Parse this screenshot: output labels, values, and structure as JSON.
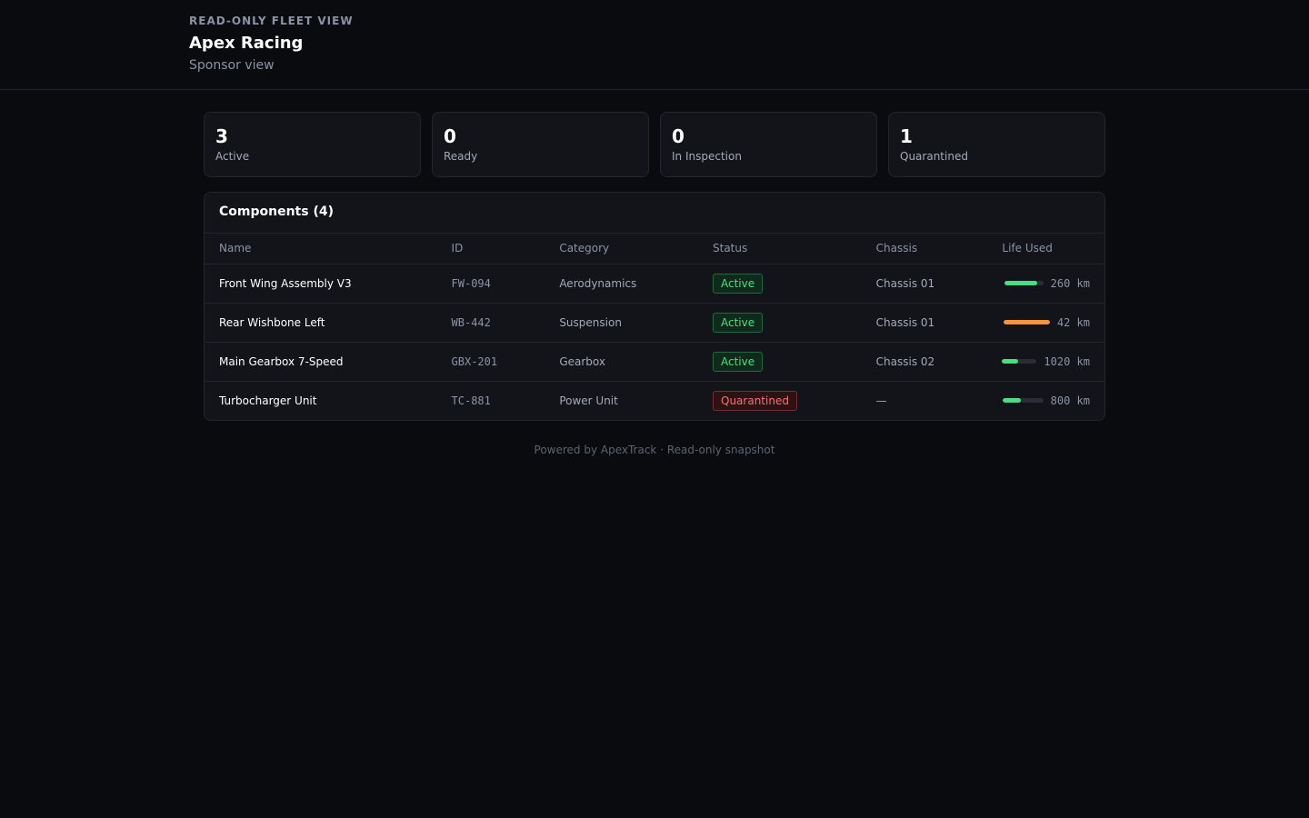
{
  "header": {
    "eyebrow": "READ-ONLY FLEET VIEW",
    "team": "Apex Racing",
    "subtitle": "Sponsor view"
  },
  "stats": [
    {
      "value": "3",
      "label": "Active"
    },
    {
      "value": "0",
      "label": "Ready"
    },
    {
      "value": "0",
      "label": "In Inspection"
    },
    {
      "value": "1",
      "label": "Quarantined"
    }
  ],
  "components": {
    "title": "Components (4)",
    "columns": [
      "Name",
      "ID",
      "Category",
      "Status",
      "Chassis",
      "Life Used"
    ],
    "rows": [
      {
        "name": "Front Wing Assembly V3",
        "id": "FW-094",
        "category": "Aerodynamics",
        "status": "Active",
        "status_kind": "active",
        "chassis": "Chassis 01",
        "life_text": "260 km",
        "life_fraction": 0.85,
        "life_color": "#4ade80"
      },
      {
        "name": "Rear Wishbone Left",
        "id": "WB-442",
        "category": "Suspension",
        "status": "Active",
        "status_kind": "active",
        "chassis": "Chassis 01",
        "life_text": "42 km",
        "life_fraction": 1.0,
        "life_color": "#fb923c"
      },
      {
        "name": "Main Gearbox 7-Speed",
        "id": "GBX-201",
        "category": "Gearbox",
        "status": "Active",
        "status_kind": "active",
        "chassis": "Chassis 02",
        "life_text": "1020 km",
        "life_fraction": 0.45,
        "life_color": "#4ade80"
      },
      {
        "name": "Turbocharger Unit",
        "id": "TC-881",
        "category": "Power Unit",
        "status": "Quarantined",
        "status_kind": "quarantined",
        "chassis": "—",
        "life_text": "800 km",
        "life_fraction": 0.45,
        "life_color": "#4ade80"
      }
    ]
  },
  "footer": "Powered by ApexTrack · Read-only snapshot"
}
